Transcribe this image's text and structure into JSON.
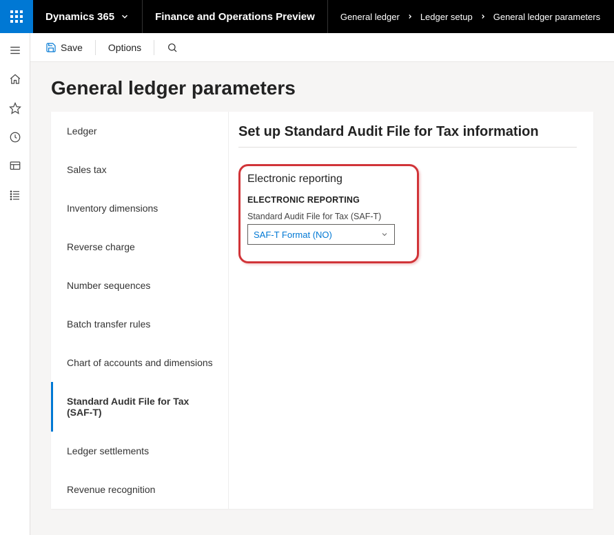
{
  "top": {
    "brand": "Dynamics 365",
    "title": "Finance and Operations Preview",
    "crumbs": [
      "General ledger",
      "Ledger setup",
      "General ledger parameters"
    ]
  },
  "cmd": {
    "save": "Save",
    "options": "Options"
  },
  "page": {
    "title": "General ledger parameters"
  },
  "tabs": [
    {
      "label": "Ledger",
      "active": false
    },
    {
      "label": "Sales tax",
      "active": false
    },
    {
      "label": "Inventory dimensions",
      "active": false
    },
    {
      "label": "Reverse charge",
      "active": false
    },
    {
      "label": "Number sequences",
      "active": false
    },
    {
      "label": "Batch transfer rules",
      "active": false
    },
    {
      "label": "Chart of accounts and dimensions",
      "active": false
    },
    {
      "label": "Standard Audit File for Tax (SAF-T)",
      "active": true
    },
    {
      "label": "Ledger settlements",
      "active": false
    },
    {
      "label": "Revenue recognition",
      "active": false
    }
  ],
  "detail": {
    "title": "Set up Standard Audit File for Tax information",
    "section_title": "Electronic reporting",
    "section_sub": "ELECTRONIC REPORTING",
    "field_label": "Standard Audit File for Tax (SAF-T)",
    "field_value": "SAF-T Format (NO)"
  }
}
